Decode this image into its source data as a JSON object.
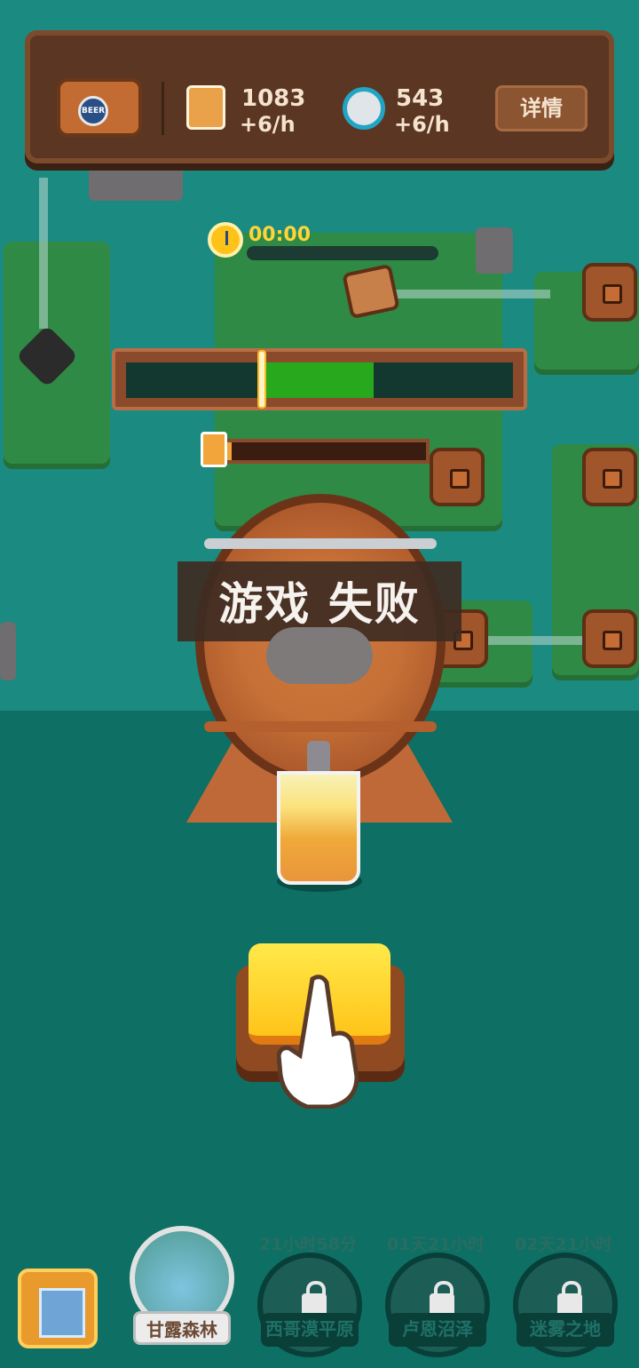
{
  "hud": {
    "resource_1": {
      "icon": "beer-glass-icon",
      "amount": "1083",
      "rate": "+6/h"
    },
    "resource_2": {
      "icon": "bottle-cap-icon",
      "amount": "543",
      "rate": "+6/h"
    },
    "details_label": "详情",
    "barrel_badge": "BEER"
  },
  "timer": {
    "text": "00:00"
  },
  "power_meter": {
    "green_zone_start": 0.36,
    "green_zone_end": 0.64,
    "marker_position": 0.35
  },
  "fill_meter": {
    "level": 0.03
  },
  "status": {
    "message": "游戏 失败"
  },
  "nav": {
    "worlds": [
      {
        "name": "甘露森林",
        "countdown": "",
        "locked": false
      },
      {
        "name": "西哥漠平原",
        "countdown": "21小时58分",
        "locked": true
      },
      {
        "name": "卢恩沼泽",
        "countdown": "01天21小时",
        "locked": true
      },
      {
        "name": "迷雾之地",
        "countdown": "02天21小时",
        "locked": true
      }
    ]
  },
  "colors": {
    "power_green": "#28a81d",
    "accent_yellow": "#ffc219",
    "background_teal": "#0e6f64"
  }
}
